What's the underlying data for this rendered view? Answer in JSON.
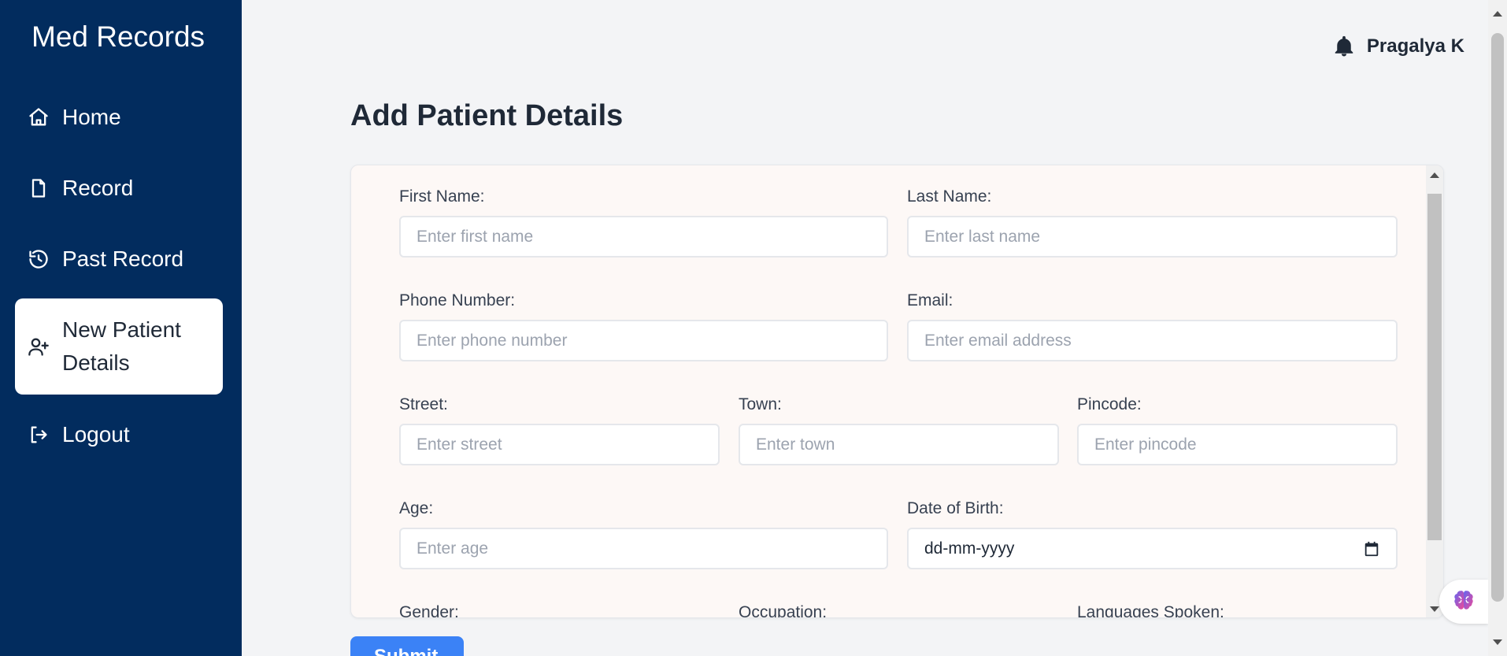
{
  "app": {
    "brand": "Med Records"
  },
  "sidebar": {
    "items": [
      {
        "label": "Home",
        "icon": "home-icon",
        "active": false
      },
      {
        "label": "Record",
        "icon": "file-icon",
        "active": false
      },
      {
        "label": "Past Record",
        "icon": "history-icon",
        "active": false
      },
      {
        "label": "New Patient Details",
        "icon": "user-plus-icon",
        "active": true
      },
      {
        "label": "Logout",
        "icon": "logout-icon",
        "active": false
      }
    ]
  },
  "header": {
    "user_name": "Pragalya K",
    "notification_icon": "bell-icon"
  },
  "page": {
    "title": "Add Patient Details"
  },
  "form": {
    "first_name": {
      "label": "First Name:",
      "placeholder": "Enter first name"
    },
    "last_name": {
      "label": "Last Name:",
      "placeholder": "Enter last name"
    },
    "phone": {
      "label": "Phone Number:",
      "placeholder": "Enter phone number"
    },
    "email": {
      "label": "Email:",
      "placeholder": "Enter email address"
    },
    "street": {
      "label": "Street:",
      "placeholder": "Enter street"
    },
    "town": {
      "label": "Town:",
      "placeholder": "Enter town"
    },
    "pincode": {
      "label": "Pincode:",
      "placeholder": "Enter pincode"
    },
    "age": {
      "label": "Age:",
      "placeholder": "Enter age"
    },
    "dob": {
      "label": "Date of Birth:",
      "value": "dd-mm-yyyy"
    },
    "gender": {
      "label": "Gender:"
    },
    "occupation": {
      "label": "Occupation:"
    },
    "languages": {
      "label": "Languages Spoken:"
    },
    "submit_label": "Submit"
  },
  "colors": {
    "sidebar_bg": "#022c5e",
    "accent": "#3b82f6",
    "card_bg": "#fdf8f6"
  }
}
